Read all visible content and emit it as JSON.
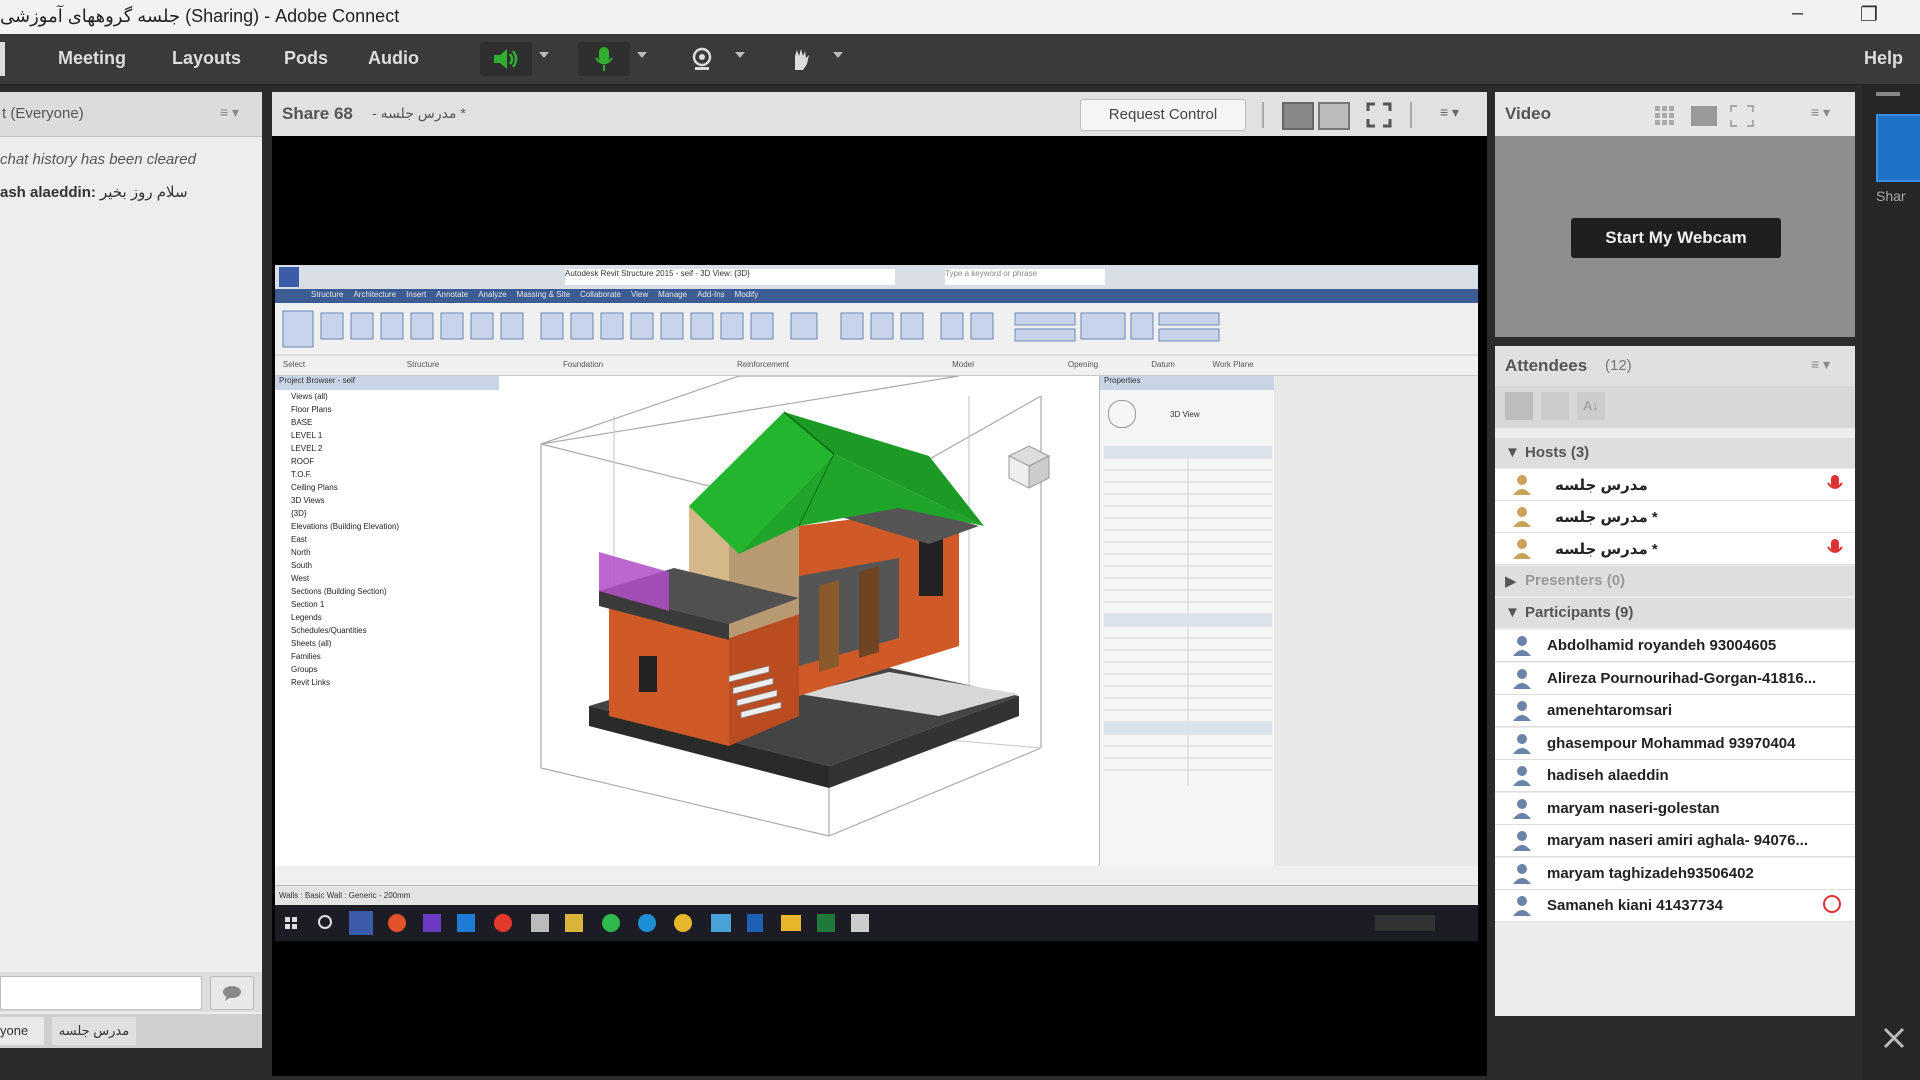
{
  "window": {
    "title": "جلسه گروههای آموزشی (Sharing) - Adobe Connect",
    "minimize": "–",
    "restore": "❐"
  },
  "menubar": {
    "items": [
      "Meeting",
      "Layouts",
      "Pods",
      "Audio"
    ],
    "help": "Help"
  },
  "chat": {
    "header": "t  (Everyone)",
    "history_notice": "chat history has been cleared",
    "message_sender": "ash alaeddin:",
    "message_text": "سلام روز بخیر",
    "tab_1": "yone",
    "tab_2": "مدرس جلسه"
  },
  "share": {
    "title": "Share 68",
    "subtitle": "- مدرس جلسه *",
    "request_control": "Request Control"
  },
  "video": {
    "title": "Video",
    "start_webcam": "Start My Webcam"
  },
  "attendees": {
    "title": "Attendees",
    "count": "(12)",
    "hosts_group": "Hosts (3)",
    "presenters_group": "Presenters (0)",
    "participants_group": "Participants (9)",
    "hosts": [
      "مدرس جلسه",
      "مدرس جلسه *",
      "مدرس جلسه *"
    ],
    "participants": [
      "Abdolhamid royandeh   93004605",
      "Alireza Pournourihad-Gorgan-41816...",
      "amenehtaromsari",
      "ghasempour Mohammad  93970404",
      "hadiseh alaeddin",
      "maryam naseri-golestan",
      "maryam naseri amiri aghala- 94076...",
      "maryam taghizadeh93506402",
      "Samaneh kiani 41437734"
    ]
  },
  "revit": {
    "title": "Autodesk Revit Structure 2015 - seif - 3D View: {3D}",
    "search_placeholder": "Type a keyword or phrase",
    "tabs": [
      "Structure",
      "Architecture",
      "Insert",
      "Annotate",
      "Analyze",
      "Massing & Site",
      "Collaborate",
      "View",
      "Manage",
      "Add-Ins",
      "Modify"
    ],
    "ribbon_groups": [
      "Select",
      "Structure",
      "Foundation",
      "Reinforcement",
      "Model",
      "Opening",
      "Datum",
      "Work Plane"
    ],
    "browser_title": "Project Browser - seif",
    "browser_items": [
      "Views (all)",
      "Floor Plans",
      "BASE",
      "LEVEL 1",
      "LEVEL 2",
      "ROOF",
      "T.O.F.",
      "Ceiling Plans",
      "3D Views",
      "{3D}",
      "Elevations (Building Elevation)",
      "East",
      "North",
      "South",
      "West",
      "Sections (Building Section)",
      "Section 1",
      "Legends",
      "Schedules/Quantities",
      "Sheets (all)",
      "Families",
      "Groups",
      "Revit Links"
    ],
    "properties_title": "Properties",
    "properties_type": "3D View",
    "status_text": "Walls : Basic Wall : Generic - 200mm"
  },
  "colors": {
    "roof": "#1fa52a",
    "brick": "#cf5a28",
    "accent_green": "#2fae2f",
    "purple": "#b04bc8"
  }
}
